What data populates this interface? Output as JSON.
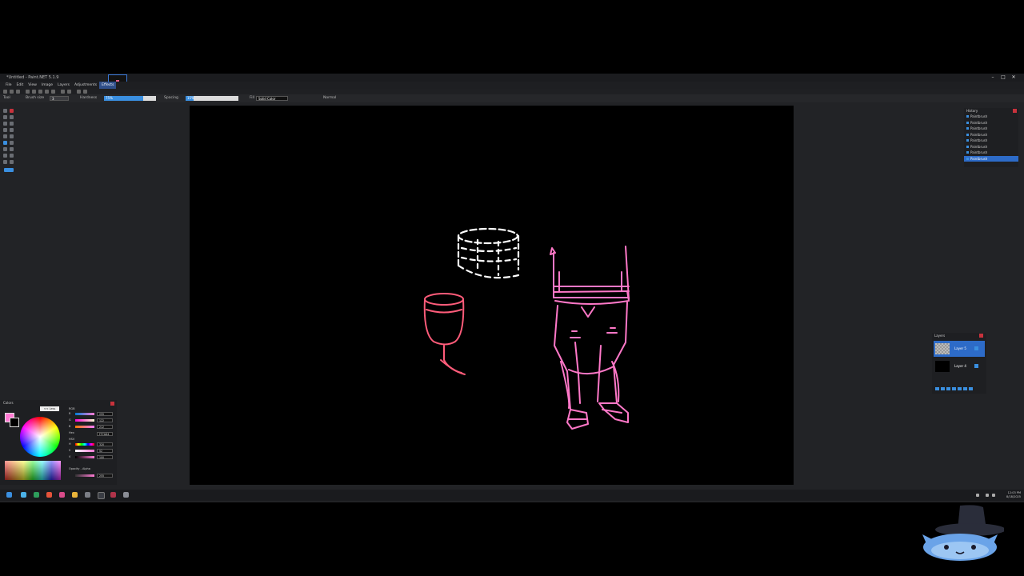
{
  "window": {
    "title": "*Untitled - Paint.NET 5.1.9",
    "controls": [
      "–",
      "□",
      "✕"
    ]
  },
  "menu": [
    "File",
    "Edit",
    "View",
    "Image",
    "Layers",
    "Adjustments",
    "Effects"
  ],
  "toolbar": {
    "tool_label": "Tool",
    "brush_size_label": "Brush size",
    "brush_size_value": "3",
    "hardness_label": "Hardness",
    "hardness_value": "75%",
    "spacing_label": "Spacing",
    "spacing_value": "15%",
    "fill_label": "Fill",
    "fill_value": "Solid Color",
    "blend_mode": "Normal"
  },
  "history": {
    "title": "History",
    "items": [
      "Paintbrush",
      "Paintbrush",
      "Paintbrush",
      "Paintbrush",
      "Paintbrush",
      "Paintbrush",
      "Paintbrush",
      "Paintbrush"
    ],
    "selected_index": 7
  },
  "layers": {
    "title": "Layers",
    "items": [
      {
        "name": "Layer 5",
        "selected": true
      },
      {
        "name": "Layer 4",
        "selected": false
      }
    ]
  },
  "colors": {
    "title": "Colors",
    "less_button": "<< Less",
    "primary": "#ff7ad4",
    "secondary": "#000000",
    "rgb_label": "RGB",
    "hex_label": "Hex",
    "hsv_label": "HSV",
    "opacity_label": "Opacity - Alpha",
    "channels": [
      {
        "label": "R",
        "value": "255"
      },
      {
        "label": "G",
        "value": "122"
      },
      {
        "label": "B",
        "value": "212"
      },
      {
        "label": "Hex",
        "value": "FF7AD4"
      },
      {
        "label": "H",
        "value": "320"
      },
      {
        "label": "S",
        "value": "52"
      },
      {
        "label": "V",
        "value": "100"
      },
      {
        "label": "A",
        "value": "255"
      }
    ]
  },
  "taskbar": {
    "time": "12:03 PM",
    "date": "8/18/2025"
  },
  "accent_colors": {
    "selection": "#2d6bc8",
    "stroke_pink": "#ff78c8",
    "stroke_red": "#ff5c7a"
  }
}
